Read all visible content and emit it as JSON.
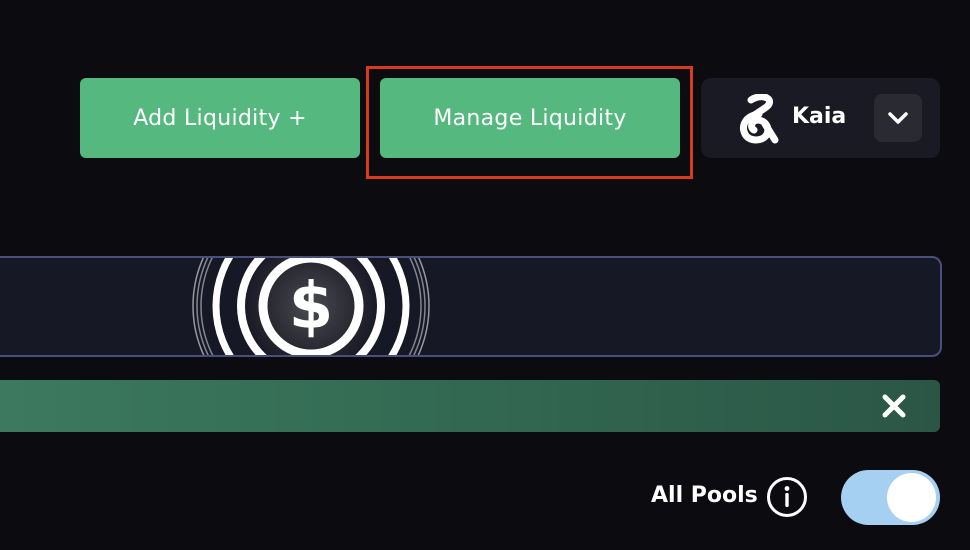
{
  "actions": {
    "add_liquidity_label": "Add Liquidity +",
    "manage_liquidity_label": "Manage Liquidity"
  },
  "network": {
    "name": "Kaia",
    "logo_icon": "kaia-logo-icon",
    "caret_icon": "chevron-down-icon"
  },
  "banner": {
    "coin_icon": "usd-coin-icon"
  },
  "notice": {
    "close_icon": "close-icon"
  },
  "filters": {
    "all_pools_label": "All Pools",
    "info_icon": "info-icon",
    "all_pools_enabled": true
  },
  "colors": {
    "accent_green": "#55b97f",
    "highlight_red": "#d83a1e",
    "toggle_on": "#a6d0f2"
  }
}
